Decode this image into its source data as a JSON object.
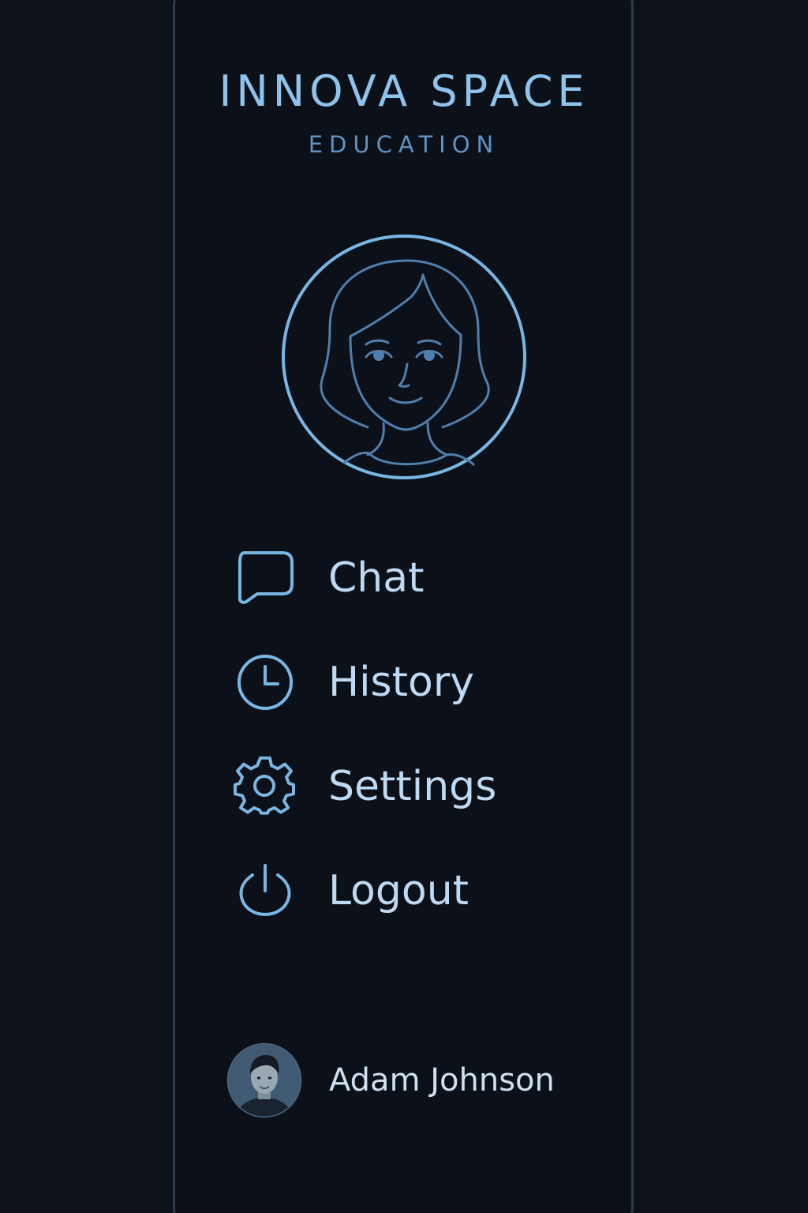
{
  "brand": {
    "title": "INNOVA SPACE",
    "subtitle": "EDUCATION"
  },
  "assistant": {
    "avatar_icon": "female-avatar-line-icon"
  },
  "menu": {
    "items": [
      {
        "label": "Chat",
        "icon": "chat-bubble-icon"
      },
      {
        "label": "History",
        "icon": "clock-icon"
      },
      {
        "label": "Settings",
        "icon": "gear-icon"
      },
      {
        "label": "Logout",
        "icon": "power-icon"
      }
    ]
  },
  "user": {
    "name": "Adam Johnson",
    "avatar_icon": "user-photo-avatar"
  },
  "colors": {
    "background": "#0d1118",
    "panel": "#0b1019",
    "panel_border": "#2c3b4c",
    "accent": "#8fc3ec",
    "label": "#bfd9f2"
  }
}
